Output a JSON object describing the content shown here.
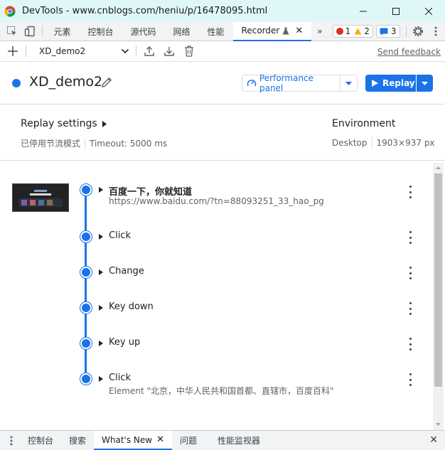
{
  "window": {
    "title": "DevTools - www.cnblogs.com/heniu/p/16478095.html"
  },
  "tabbar": {
    "tabs": [
      {
        "label": "元素"
      },
      {
        "label": "控制台"
      },
      {
        "label": "源代码"
      },
      {
        "label": "网络"
      },
      {
        "label": "性能"
      },
      {
        "label": "Recorder",
        "active": true
      }
    ],
    "more": "»",
    "errors": "1",
    "warnings": "2",
    "messages": "3"
  },
  "recorder_toolbar": {
    "selected_recording": "XD_demo2",
    "feedback": "Send feedback"
  },
  "header": {
    "recording_name": "XD_demo2",
    "performance_button": "Performance panel",
    "replay_button": "Replay"
  },
  "settings": {
    "title": "Replay settings",
    "throttling": "已停用节流模式",
    "timeout": "Timeout: 5000 ms",
    "env_title": "Environment",
    "device": "Desktop",
    "viewport": "1903×937 px"
  },
  "steps": [
    {
      "title": "百度一下，你就知道",
      "subtitle": "https://www.baidu.com/?tn=88093251_33_hao_pg",
      "bold": true
    },
    {
      "title": "Click",
      "subtitle": ""
    },
    {
      "title": "Change",
      "subtitle": ""
    },
    {
      "title": "Key down",
      "subtitle": ""
    },
    {
      "title": "Key up",
      "subtitle": ""
    },
    {
      "title": "Click",
      "subtitle": "Element \"北京，中华人民共和国首都、直辖市，百度百科\""
    }
  ],
  "drawer": {
    "tabs": [
      {
        "label": "控制台"
      },
      {
        "label": "搜索"
      },
      {
        "label": "What's New",
        "active": true
      },
      {
        "label": "问题"
      },
      {
        "label": "性能监视器"
      }
    ]
  },
  "colors": {
    "accent": "#1a73e8",
    "titlebar_bg": "#e0f7f8"
  }
}
